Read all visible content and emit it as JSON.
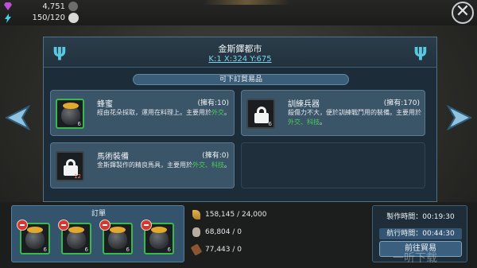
{
  "header": {
    "gems": "4,751",
    "energy": "150/120"
  },
  "panel": {
    "city_name": "金斯鐸都市",
    "coords": "K:1 X:324 Y:675",
    "section_label": "可下訂貿易品"
  },
  "items": [
    {
      "title": "蜂蜜",
      "owned": "(擁有:10)",
      "desc_before": "經由花朵採取，運用在料理上。主要用於",
      "desc_highlight": "外交",
      "desc_after": "。",
      "slot_count": "6",
      "locked": false
    },
    {
      "title": "訓練兵器",
      "owned": "(擁有:170)",
      "desc_before": "殺傷力不大，便於訓練戰鬥用的裝備。主要用於",
      "desc_highlight": "外交、科技",
      "desc_after": "。",
      "slot_count": "6",
      "locked": true
    },
    {
      "title": "馬術裝備",
      "owned": "(擁有:0)",
      "desc_before": "金斯鐸製作的精良馬具，主要用於",
      "desc_highlight": "外交、科技",
      "desc_after": "。",
      "slot_count": "12",
      "locked": true
    }
  ],
  "orders": {
    "title": "訂單",
    "slots": [
      "6",
      "6",
      "6",
      "6"
    ]
  },
  "resources": [
    {
      "icon": "wheat-icon",
      "value": "158,145 / 24,000"
    },
    {
      "icon": "stone-icon",
      "value": "68,804 / 0"
    },
    {
      "icon": "wood-icon",
      "value": "77,443 / 0"
    }
  ],
  "times": {
    "make_time": "製作時間：00:19:30",
    "sail_time": "航行時間：00:44:30",
    "goto_button": "前往貿易"
  },
  "watermark": "一听下载",
  "colors": {
    "highlight": "#4ccf57",
    "coords_link": "#79d4ee",
    "slot_border_green": "#39b84d",
    "remove_badge": "#d23a2f"
  }
}
